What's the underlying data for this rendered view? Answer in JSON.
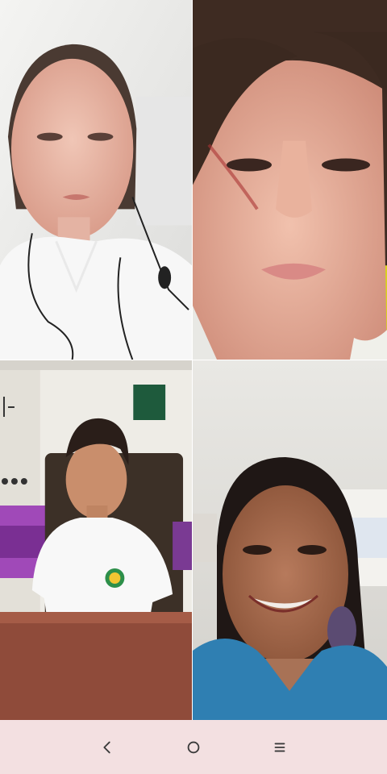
{
  "call": {
    "participants": [
      {
        "id": "participant-1",
        "tile": "top-left"
      },
      {
        "id": "participant-2",
        "tile": "top-right"
      },
      {
        "id": "participant-3",
        "tile": "bottom-left"
      },
      {
        "id": "participant-4",
        "tile": "bottom-right"
      }
    ]
  },
  "navbar": {
    "background": "#f3e0e1",
    "icon_color": "#3a3a3a",
    "buttons": [
      {
        "name": "back-button",
        "icon": "chevron-left-icon"
      },
      {
        "name": "home-button",
        "icon": "circle-home-icon"
      },
      {
        "name": "recents-button",
        "icon": "menu-lines-icon"
      }
    ]
  }
}
